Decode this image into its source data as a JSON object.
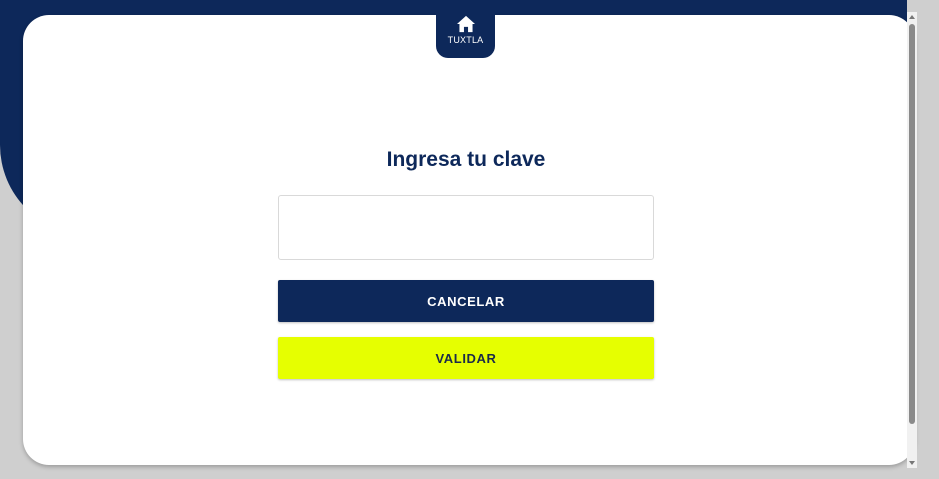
{
  "header": {
    "home_tab": {
      "label": "TUXTLA",
      "icon": "home-icon"
    }
  },
  "main": {
    "title": "Ingresa tu clave",
    "password_input": {
      "value": "",
      "placeholder": ""
    },
    "buttons": {
      "cancel_label": "CANCELAR",
      "validate_label": "VALIDAR"
    }
  },
  "colors": {
    "brand_navy": "#0d285a",
    "accent_lime": "#e6ff00",
    "background_gray": "#cfcfcf",
    "card_white": "#ffffff"
  }
}
